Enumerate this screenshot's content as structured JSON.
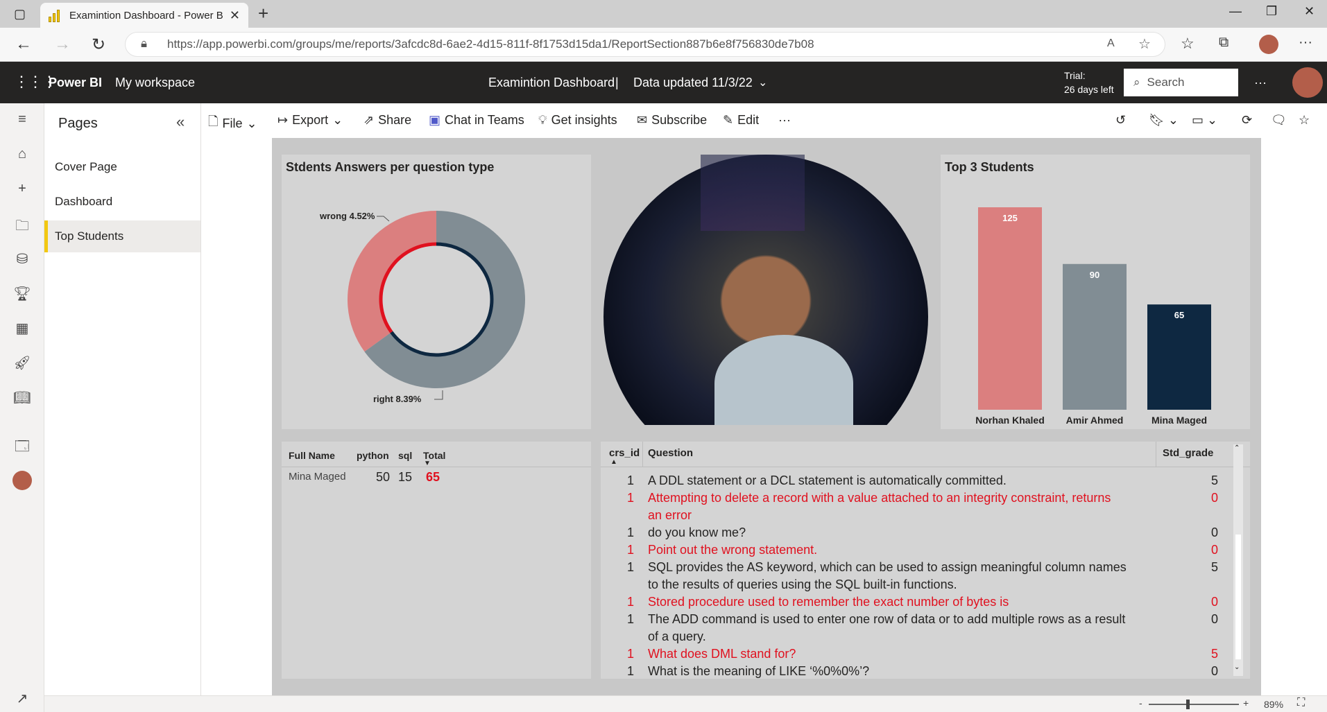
{
  "browser": {
    "tab_title": "Examintion Dashboard - Power B",
    "url": "https://app.powerbi.com/groups/me/reports/3afcdc8d-6ae2-4d15-811f-8f1753d15da1/ReportSection887b6e8f756830de7b08"
  },
  "header": {
    "app_name": "Power BI",
    "workspace": "My workspace",
    "report_title": "Examintion Dashboard",
    "separator": "|",
    "data_updated": "Data updated 11/3/22",
    "trial_line1": "Trial:",
    "trial_line2": "26 days left",
    "search_placeholder": "Search",
    "more": "···"
  },
  "pages_pane": {
    "title": "Pages",
    "items": [
      "Cover Page",
      "Dashboard",
      "Top Students"
    ],
    "active_index": 2
  },
  "toolbar": {
    "file": "File",
    "export": "Export",
    "share": "Share",
    "chat": "Chat in Teams",
    "insights": "Get insights",
    "subscribe": "Subscribe",
    "edit": "Edit",
    "more": "···"
  },
  "donut_card": {
    "title": "Stdents Answers per question type",
    "outer_labels": [
      "wrong 4.52%",
      "right 8.39%"
    ],
    "colors": {
      "wrong": "#db7f7f",
      "right": "#818d94",
      "inner_wrong": "#e0111f",
      "inner_right": "#0e2841"
    }
  },
  "chart_data": {
    "type": "bar",
    "title": "Top 3 Students",
    "categories": [
      "Norhan Khaled",
      "Amir Ahmed",
      "Mina Maged"
    ],
    "values": [
      125,
      90,
      65
    ],
    "colors": [
      "#db7f7f",
      "#818d94",
      "#0e2841"
    ],
    "ylim": [
      0,
      125
    ]
  },
  "score_table": {
    "headers": [
      "Full Name",
      "python",
      "sql",
      "Total"
    ],
    "row": {
      "name": "Mina Maged",
      "python": "50",
      "sql": "15",
      "total": "65"
    }
  },
  "questions_table": {
    "headers": [
      "crs_id",
      "Question",
      "Std_grade"
    ],
    "rows": [
      {
        "id": "1",
        "q1": "A DDL statement or a DCL statement is automatically committed.",
        "q2": "",
        "grade": "5",
        "red": false
      },
      {
        "id": "1",
        "q1": "Attempting to delete a record with a value attached to an integrity constraint, returns",
        "q2": "an error",
        "grade": "0",
        "red": true
      },
      {
        "id": "1",
        "q1": "do you know me?",
        "q2": "",
        "grade": "0",
        "red": false
      },
      {
        "id": "1",
        "q1": "Point out the wrong statement.",
        "q2": "",
        "grade": "0",
        "red": true
      },
      {
        "id": "1",
        "q1": "SQL provides the AS keyword, which can be used to assign meaningful column names",
        "q2": "to the results of queries using the SQL built-in functions.",
        "grade": "5",
        "red": false
      },
      {
        "id": "1",
        "q1": "Stored procedure used to remember the exact number of bytes is",
        "q2": "",
        "grade": "0",
        "red": true
      },
      {
        "id": "1",
        "q1": "The ADD command is used to enter one row of data or to add multiple rows as a result",
        "q2": "of a query.",
        "grade": "0",
        "red": false
      },
      {
        "id": "1",
        "q1": "What does DML stand for?",
        "q2": "",
        "grade": "5",
        "red": true
      },
      {
        "id": "1",
        "q1": "What is the meaning of LIKE ‘%0%0%’?",
        "q2": "",
        "grade": "0",
        "red": false
      }
    ]
  },
  "status_bar": {
    "zoom_minus": "-",
    "zoom_plus": "+",
    "zoom": "89%"
  }
}
